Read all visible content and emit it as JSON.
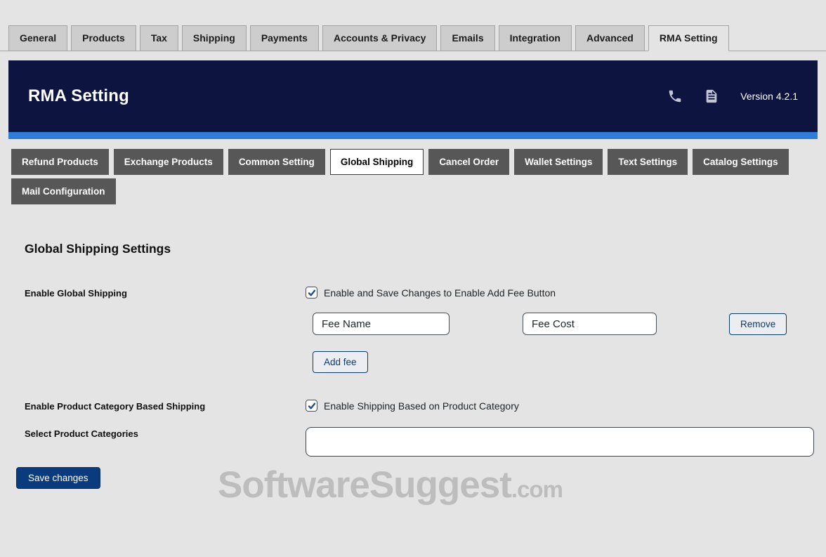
{
  "colors": {
    "header_bg": "#0d1440",
    "accent_strip": "#2e7dd9",
    "subtab_bg": "#575757",
    "primary_button_bg": "#0a3b7d",
    "secondary_button_text": "#0a3a72",
    "checkbox_check": "#1f4e8d",
    "watermark": "#bdbdbd"
  },
  "top_tabs": [
    {
      "label": "General",
      "active": false
    },
    {
      "label": "Products",
      "active": false
    },
    {
      "label": "Tax",
      "active": false
    },
    {
      "label": "Shipping",
      "active": false
    },
    {
      "label": "Payments",
      "active": false
    },
    {
      "label": "Accounts & Privacy",
      "active": false
    },
    {
      "label": "Emails",
      "active": false
    },
    {
      "label": "Integration",
      "active": false
    },
    {
      "label": "Advanced",
      "active": false
    },
    {
      "label": "RMA Setting",
      "active": true
    }
  ],
  "header": {
    "title": "RMA Setting",
    "icons": [
      "phone-icon",
      "document-icon"
    ],
    "version": "Version 4.2.1"
  },
  "sub_tabs": [
    {
      "label": "Refund Products",
      "active": false
    },
    {
      "label": "Exchange Products",
      "active": false
    },
    {
      "label": "Common Setting",
      "active": false
    },
    {
      "label": "Global Shipping",
      "active": true
    },
    {
      "label": "Cancel Order",
      "active": false
    },
    {
      "label": "Wallet Settings",
      "active": false
    },
    {
      "label": "Text Settings",
      "active": false
    },
    {
      "label": "Catalog Settings",
      "active": false
    },
    {
      "label": "Mail Configuration",
      "active": false
    }
  ],
  "section": {
    "title": "Global Shipping Settings"
  },
  "form": {
    "enable_global_shipping": {
      "label": "Enable Global Shipping",
      "checkbox_label": "Enable and Save Changes to Enable Add Fee Button",
      "checked": true
    },
    "fee_row": {
      "fee_name": "Fee Name",
      "fee_cost": "Fee Cost",
      "remove_label": "Remove"
    },
    "add_fee_label": "Add fee",
    "enable_category_shipping": {
      "label": "Enable Product Category Based Shipping",
      "checkbox_label": "Enable Shipping Based on Product Category",
      "checked": true
    },
    "select_categories": {
      "label": "Select Product Categories",
      "value": ""
    },
    "save_label": "Save changes"
  },
  "watermark": {
    "main": "SoftwareSuggest",
    "suffix": ".com"
  }
}
